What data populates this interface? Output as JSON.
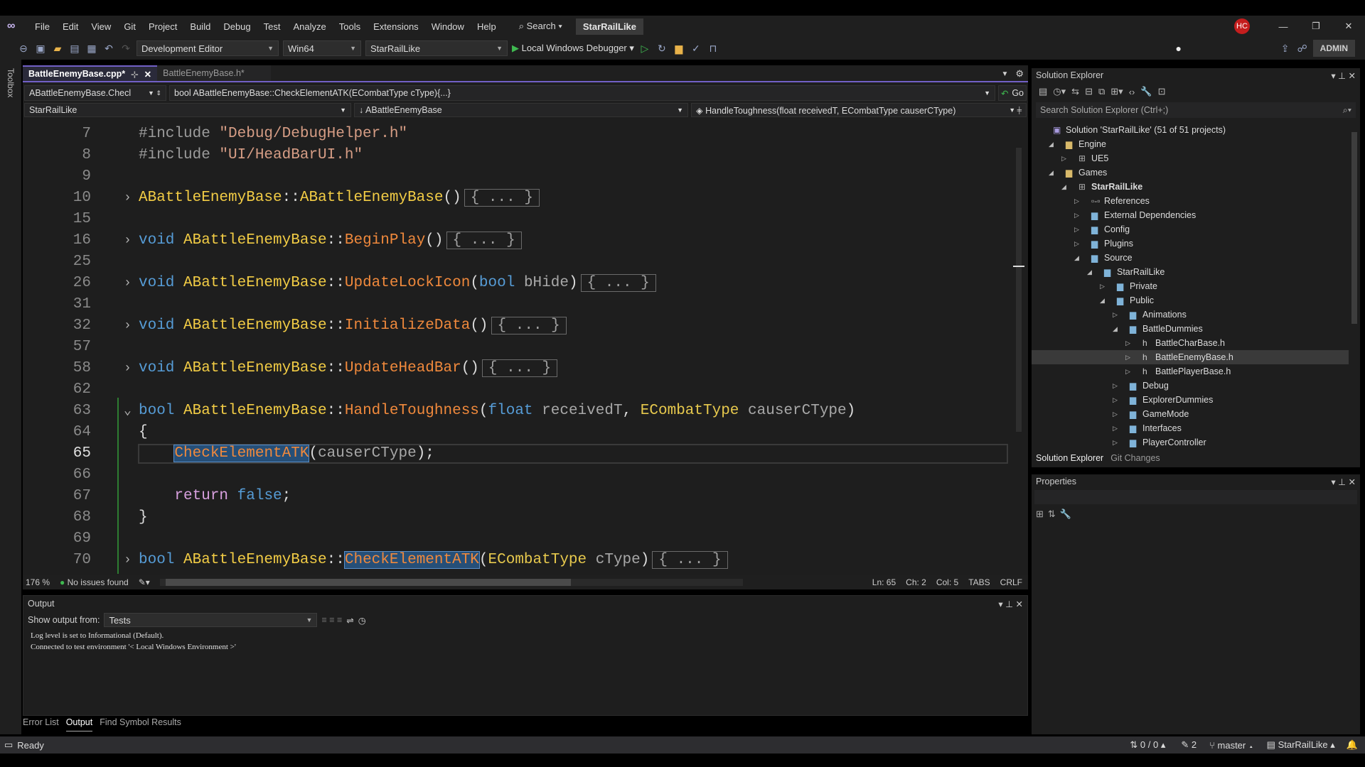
{
  "menu": {
    "items": [
      "File",
      "Edit",
      "View",
      "Git",
      "Project",
      "Build",
      "Debug",
      "Test",
      "Analyze",
      "Tools",
      "Extensions",
      "Window",
      "Help"
    ],
    "search": "Search",
    "solution_title": "StarRailLike",
    "user_initials": "HC",
    "admin": "ADMIN"
  },
  "toolbar": {
    "config": "Development Editor",
    "platform": "Win64",
    "project": "StarRailLike",
    "debugger": "Local Windows Debugger"
  },
  "toolbox_label": "Toolbox",
  "tabs": [
    {
      "label": "BattleEnemyBase.cpp*",
      "active": true
    },
    {
      "label": "BattleEnemyBase.h*",
      "active": false
    }
  ],
  "nav": {
    "scope": "ABattleEnemyBase.Checl",
    "member": "bool ABattleEnemyBase::CheckElementATK(ECombatType cType){...}",
    "go": "Go",
    "project": "StarRailLike",
    "class": "ABattleEnemyBase",
    "function": "HandleToughness(float receivedT, ECombatType causerCType)"
  },
  "code": [
    {
      "n": "7",
      "fold": "",
      "tokens": [
        [
          "#include ",
          "p"
        ],
        [
          "\"Debug/DebugHelper.h\"",
          "s"
        ]
      ]
    },
    {
      "n": "8",
      "fold": "",
      "tokens": [
        [
          "#include ",
          "p"
        ],
        [
          "\"UI/HeadBarUI.h\"",
          "s"
        ]
      ]
    },
    {
      "n": "9",
      "fold": "",
      "tokens": []
    },
    {
      "n": "10",
      "fold": ">",
      "tokens": [
        [
          "ABattleEnemyBase",
          "c"
        ],
        [
          "::",
          "t"
        ],
        [
          "ABattleEnemyBase",
          "c"
        ],
        [
          "()",
          "t"
        ],
        [
          "{ ... }",
          "fold"
        ]
      ]
    },
    {
      "n": "15",
      "fold": "",
      "tokens": []
    },
    {
      "n": "16",
      "fold": ">",
      "tokens": [
        [
          "void ",
          "k"
        ],
        [
          "ABattleEnemyBase",
          "c"
        ],
        [
          "::",
          "t"
        ],
        [
          "BeginPlay",
          "f"
        ],
        [
          "()",
          "t"
        ],
        [
          "{ ... }",
          "fold"
        ]
      ]
    },
    {
      "n": "25",
      "fold": "",
      "tokens": []
    },
    {
      "n": "26",
      "fold": ">",
      "tokens": [
        [
          "void ",
          "k"
        ],
        [
          "ABattleEnemyBase",
          "c"
        ],
        [
          "::",
          "t"
        ],
        [
          "UpdateLockIcon",
          "f"
        ],
        [
          "(",
          "t"
        ],
        [
          "bool ",
          "k"
        ],
        [
          "bHide",
          "v"
        ],
        [
          ")",
          "t"
        ],
        [
          "{ ... }",
          "fold"
        ]
      ]
    },
    {
      "n": "31",
      "fold": "",
      "tokens": []
    },
    {
      "n": "32",
      "fold": ">",
      "tokens": [
        [
          "void ",
          "k"
        ],
        [
          "ABattleEnemyBase",
          "c"
        ],
        [
          "::",
          "t"
        ],
        [
          "InitializeData",
          "f"
        ],
        [
          "()",
          "t"
        ],
        [
          "{ ... }",
          "fold"
        ]
      ]
    },
    {
      "n": "57",
      "fold": "",
      "tokens": []
    },
    {
      "n": "58",
      "fold": ">",
      "tokens": [
        [
          "void ",
          "k"
        ],
        [
          "ABattleEnemyBase",
          "c"
        ],
        [
          "::",
          "t"
        ],
        [
          "UpdateHeadBar",
          "f"
        ],
        [
          "()",
          "t"
        ],
        [
          "{ ... }",
          "fold"
        ]
      ]
    },
    {
      "n": "62",
      "fold": "",
      "tokens": []
    },
    {
      "n": "63",
      "fold": "v",
      "tokens": [
        [
          "bool ",
          "k"
        ],
        [
          "ABattleEnemyBase",
          "c"
        ],
        [
          "::",
          "t"
        ],
        [
          "HandleToughness",
          "f"
        ],
        [
          "(",
          "t"
        ],
        [
          "float ",
          "k"
        ],
        [
          "receivedT",
          "v"
        ],
        [
          ", ",
          "t"
        ],
        [
          "ECombatType ",
          "e"
        ],
        [
          "causerCType",
          "v"
        ],
        [
          ")",
          "t"
        ]
      ]
    },
    {
      "n": "64",
      "fold": "",
      "tokens": [
        [
          "{",
          "t"
        ]
      ]
    },
    {
      "n": "65",
      "fold": "",
      "current": true,
      "tokens": [
        [
          "    ",
          "t"
        ],
        [
          "CheckElementATK",
          "f hl"
        ],
        [
          "(",
          "t"
        ],
        [
          "causerCType",
          "v"
        ],
        [
          ");",
          "t"
        ]
      ]
    },
    {
      "n": "66",
      "fold": "",
      "tokens": []
    },
    {
      "n": "67",
      "fold": "",
      "tokens": [
        [
          "    ",
          "t"
        ],
        [
          "return ",
          "r"
        ],
        [
          "false",
          "k"
        ],
        [
          ";",
          "t"
        ]
      ]
    },
    {
      "n": "68",
      "fold": "",
      "tokens": [
        [
          "}",
          "t"
        ]
      ]
    },
    {
      "n": "69",
      "fold": "",
      "tokens": []
    },
    {
      "n": "70",
      "fold": ">",
      "tokens": [
        [
          "bool ",
          "k"
        ],
        [
          "ABattleEnemyBase",
          "c"
        ],
        [
          "::",
          "t"
        ],
        [
          "CheckElementATK",
          "f hl"
        ],
        [
          "(",
          "t"
        ],
        [
          "ECombatType ",
          "e"
        ],
        [
          "cType",
          "v"
        ],
        [
          ")",
          "t"
        ],
        [
          "{ ... }",
          "fold"
        ]
      ]
    }
  ],
  "editor_status": {
    "zoom": "176 %",
    "issues": "No issues found",
    "ln": "Ln: 65",
    "ch": "Ch: 2",
    "col": "Col: 5",
    "tabs": "TABS",
    "eol": "CRLF"
  },
  "output": {
    "title": "Output",
    "show_from_label": "Show output from:",
    "source": "Tests",
    "lines": [
      "Log level is set to Informational (Default).",
      "Connected to test environment '< Local Windows Environment >'"
    ]
  },
  "bottom_tabs": [
    "Error List",
    "Output",
    "Find Symbol Results"
  ],
  "status": {
    "ready": "Ready",
    "changes": "0 / 0",
    "pending": "2",
    "branch": "master",
    "repo": "StarRailLike"
  },
  "solution_explorer": {
    "title": "Solution Explorer",
    "search_placeholder": "Search Solution Explorer (Ctrl+;)",
    "tabs": [
      "Solution Explorer",
      "Git Changes"
    ],
    "nodes": [
      {
        "label": "Solution 'StarRailLike' (51 of 51 projects)",
        "level": 0,
        "exp": "",
        "icon": "solution"
      },
      {
        "label": "Engine",
        "level": 1,
        "exp": "open",
        "icon": "folder"
      },
      {
        "label": "UE5",
        "level": 2,
        "exp": "closed",
        "icon": "project"
      },
      {
        "label": "Games",
        "level": 1,
        "exp": "open",
        "icon": "folder"
      },
      {
        "label": "StarRailLike",
        "level": 2,
        "exp": "open",
        "icon": "project",
        "bold": true
      },
      {
        "label": "References",
        "level": 3,
        "exp": "closed",
        "icon": "references"
      },
      {
        "label": "External Dependencies",
        "level": 3,
        "exp": "closed",
        "icon": "filter"
      },
      {
        "label": "Config",
        "level": 3,
        "exp": "closed",
        "icon": "filter"
      },
      {
        "label": "Plugins",
        "level": 3,
        "exp": "closed",
        "icon": "filter"
      },
      {
        "label": "Source",
        "level": 3,
        "exp": "open",
        "icon": "filter"
      },
      {
        "label": "StarRailLike",
        "level": 4,
        "exp": "open",
        "icon": "filter"
      },
      {
        "label": "Private",
        "level": 5,
        "exp": "closed",
        "icon": "filter"
      },
      {
        "label": "Public",
        "level": 5,
        "exp": "open",
        "icon": "filter"
      },
      {
        "label": "Animations",
        "level": 6,
        "exp": "closed",
        "icon": "filter"
      },
      {
        "label": "BattleDummies",
        "level": 6,
        "exp": "open",
        "icon": "filter"
      },
      {
        "label": "BattleCharBase.h",
        "level": 7,
        "exp": "closed",
        "icon": "header"
      },
      {
        "label": "BattleEnemyBase.h",
        "level": 7,
        "exp": "closed",
        "icon": "header",
        "selected": true
      },
      {
        "label": "BattlePlayerBase.h",
        "level": 7,
        "exp": "closed",
        "icon": "header"
      },
      {
        "label": "Debug",
        "level": 6,
        "exp": "closed",
        "icon": "filter"
      },
      {
        "label": "ExplorerDummies",
        "level": 6,
        "exp": "closed",
        "icon": "filter"
      },
      {
        "label": "GameMode",
        "level": 6,
        "exp": "closed",
        "icon": "filter"
      },
      {
        "label": "Interfaces",
        "level": 6,
        "exp": "closed",
        "icon": "filter"
      },
      {
        "label": "PlayerController",
        "level": 6,
        "exp": "closed",
        "icon": "filter"
      }
    ]
  },
  "properties": {
    "title": "Properties"
  },
  "colors": {
    "accent": "#7160c6",
    "keyword": "#569cd6",
    "class": "#f2cc45",
    "function": "#f0893c",
    "string": "#d69d85",
    "selection": "#264f78"
  }
}
